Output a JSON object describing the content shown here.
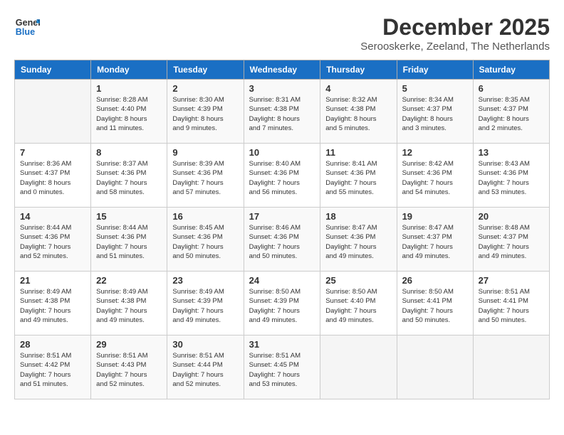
{
  "header": {
    "logo_line1": "General",
    "logo_line2": "Blue",
    "month_title": "December 2025",
    "subtitle": "Serooskerke, Zeeland, The Netherlands"
  },
  "columns": [
    "Sunday",
    "Monday",
    "Tuesday",
    "Wednesday",
    "Thursday",
    "Friday",
    "Saturday"
  ],
  "weeks": [
    [
      {
        "num": "",
        "info": ""
      },
      {
        "num": "1",
        "info": "Sunrise: 8:28 AM\nSunset: 4:40 PM\nDaylight: 8 hours\nand 11 minutes."
      },
      {
        "num": "2",
        "info": "Sunrise: 8:30 AM\nSunset: 4:39 PM\nDaylight: 8 hours\nand 9 minutes."
      },
      {
        "num": "3",
        "info": "Sunrise: 8:31 AM\nSunset: 4:38 PM\nDaylight: 8 hours\nand 7 minutes."
      },
      {
        "num": "4",
        "info": "Sunrise: 8:32 AM\nSunset: 4:38 PM\nDaylight: 8 hours\nand 5 minutes."
      },
      {
        "num": "5",
        "info": "Sunrise: 8:34 AM\nSunset: 4:37 PM\nDaylight: 8 hours\nand 3 minutes."
      },
      {
        "num": "6",
        "info": "Sunrise: 8:35 AM\nSunset: 4:37 PM\nDaylight: 8 hours\nand 2 minutes."
      }
    ],
    [
      {
        "num": "7",
        "info": "Sunrise: 8:36 AM\nSunset: 4:37 PM\nDaylight: 8 hours\nand 0 minutes."
      },
      {
        "num": "8",
        "info": "Sunrise: 8:37 AM\nSunset: 4:36 PM\nDaylight: 7 hours\nand 58 minutes."
      },
      {
        "num": "9",
        "info": "Sunrise: 8:39 AM\nSunset: 4:36 PM\nDaylight: 7 hours\nand 57 minutes."
      },
      {
        "num": "10",
        "info": "Sunrise: 8:40 AM\nSunset: 4:36 PM\nDaylight: 7 hours\nand 56 minutes."
      },
      {
        "num": "11",
        "info": "Sunrise: 8:41 AM\nSunset: 4:36 PM\nDaylight: 7 hours\nand 55 minutes."
      },
      {
        "num": "12",
        "info": "Sunrise: 8:42 AM\nSunset: 4:36 PM\nDaylight: 7 hours\nand 54 minutes."
      },
      {
        "num": "13",
        "info": "Sunrise: 8:43 AM\nSunset: 4:36 PM\nDaylight: 7 hours\nand 53 minutes."
      }
    ],
    [
      {
        "num": "14",
        "info": "Sunrise: 8:44 AM\nSunset: 4:36 PM\nDaylight: 7 hours\nand 52 minutes."
      },
      {
        "num": "15",
        "info": "Sunrise: 8:44 AM\nSunset: 4:36 PM\nDaylight: 7 hours\nand 51 minutes."
      },
      {
        "num": "16",
        "info": "Sunrise: 8:45 AM\nSunset: 4:36 PM\nDaylight: 7 hours\nand 50 minutes."
      },
      {
        "num": "17",
        "info": "Sunrise: 8:46 AM\nSunset: 4:36 PM\nDaylight: 7 hours\nand 50 minutes."
      },
      {
        "num": "18",
        "info": "Sunrise: 8:47 AM\nSunset: 4:36 PM\nDaylight: 7 hours\nand 49 minutes."
      },
      {
        "num": "19",
        "info": "Sunrise: 8:47 AM\nSunset: 4:37 PM\nDaylight: 7 hours\nand 49 minutes."
      },
      {
        "num": "20",
        "info": "Sunrise: 8:48 AM\nSunset: 4:37 PM\nDaylight: 7 hours\nand 49 minutes."
      }
    ],
    [
      {
        "num": "21",
        "info": "Sunrise: 8:49 AM\nSunset: 4:38 PM\nDaylight: 7 hours\nand 49 minutes."
      },
      {
        "num": "22",
        "info": "Sunrise: 8:49 AM\nSunset: 4:38 PM\nDaylight: 7 hours\nand 49 minutes."
      },
      {
        "num": "23",
        "info": "Sunrise: 8:49 AM\nSunset: 4:39 PM\nDaylight: 7 hours\nand 49 minutes."
      },
      {
        "num": "24",
        "info": "Sunrise: 8:50 AM\nSunset: 4:39 PM\nDaylight: 7 hours\nand 49 minutes."
      },
      {
        "num": "25",
        "info": "Sunrise: 8:50 AM\nSunset: 4:40 PM\nDaylight: 7 hours\nand 49 minutes."
      },
      {
        "num": "26",
        "info": "Sunrise: 8:50 AM\nSunset: 4:41 PM\nDaylight: 7 hours\nand 50 minutes."
      },
      {
        "num": "27",
        "info": "Sunrise: 8:51 AM\nSunset: 4:41 PM\nDaylight: 7 hours\nand 50 minutes."
      }
    ],
    [
      {
        "num": "28",
        "info": "Sunrise: 8:51 AM\nSunset: 4:42 PM\nDaylight: 7 hours\nand 51 minutes."
      },
      {
        "num": "29",
        "info": "Sunrise: 8:51 AM\nSunset: 4:43 PM\nDaylight: 7 hours\nand 52 minutes."
      },
      {
        "num": "30",
        "info": "Sunrise: 8:51 AM\nSunset: 4:44 PM\nDaylight: 7 hours\nand 52 minutes."
      },
      {
        "num": "31",
        "info": "Sunrise: 8:51 AM\nSunset: 4:45 PM\nDaylight: 7 hours\nand 53 minutes."
      },
      {
        "num": "",
        "info": ""
      },
      {
        "num": "",
        "info": ""
      },
      {
        "num": "",
        "info": ""
      }
    ]
  ]
}
